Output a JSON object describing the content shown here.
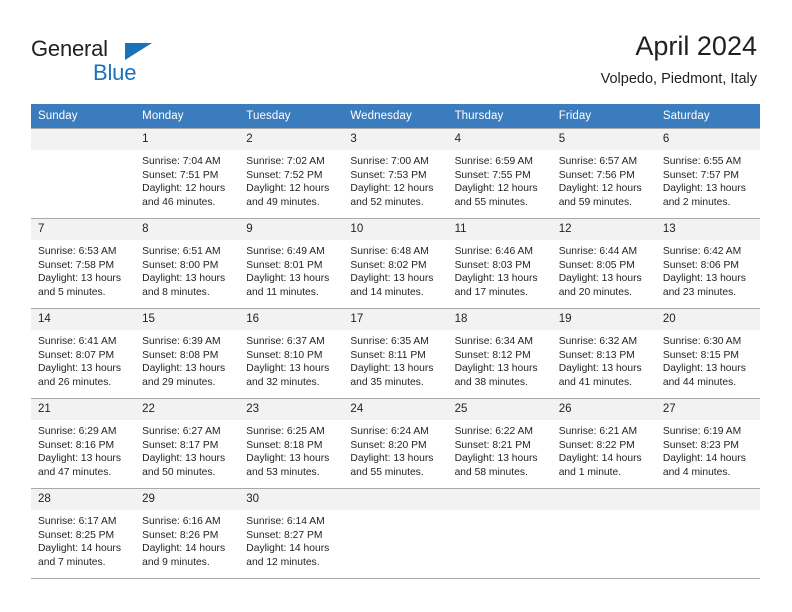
{
  "brand": {
    "name_part1": "General",
    "name_part2": "Blue",
    "accent_color": "#1b72b8"
  },
  "header": {
    "title": "April 2024",
    "subtitle": "Volpedo, Piedmont, Italy",
    "header_bg_color": "#3b7cbf",
    "daynum_bg_color": "#f2f2f2"
  },
  "weekday_headers": [
    "Sunday",
    "Monday",
    "Tuesday",
    "Wednesday",
    "Thursday",
    "Friday",
    "Saturday"
  ],
  "weeks": [
    [
      {
        "day": "",
        "blank": true,
        "l1": "",
        "l2": "",
        "l3": "",
        "l4": ""
      },
      {
        "day": "1",
        "l1": "Sunrise: 7:04 AM",
        "l2": "Sunset: 7:51 PM",
        "l3": "Daylight: 12 hours",
        "l4": "and 46 minutes."
      },
      {
        "day": "2",
        "l1": "Sunrise: 7:02 AM",
        "l2": "Sunset: 7:52 PM",
        "l3": "Daylight: 12 hours",
        "l4": "and 49 minutes."
      },
      {
        "day": "3",
        "l1": "Sunrise: 7:00 AM",
        "l2": "Sunset: 7:53 PM",
        "l3": "Daylight: 12 hours",
        "l4": "and 52 minutes."
      },
      {
        "day": "4",
        "l1": "Sunrise: 6:59 AM",
        "l2": "Sunset: 7:55 PM",
        "l3": "Daylight: 12 hours",
        "l4": "and 55 minutes."
      },
      {
        "day": "5",
        "l1": "Sunrise: 6:57 AM",
        "l2": "Sunset: 7:56 PM",
        "l3": "Daylight: 12 hours",
        "l4": "and 59 minutes."
      },
      {
        "day": "6",
        "l1": "Sunrise: 6:55 AM",
        "l2": "Sunset: 7:57 PM",
        "l3": "Daylight: 13 hours",
        "l4": "and 2 minutes."
      }
    ],
    [
      {
        "day": "7",
        "l1": "Sunrise: 6:53 AM",
        "l2": "Sunset: 7:58 PM",
        "l3": "Daylight: 13 hours",
        "l4": "and 5 minutes."
      },
      {
        "day": "8",
        "l1": "Sunrise: 6:51 AM",
        "l2": "Sunset: 8:00 PM",
        "l3": "Daylight: 13 hours",
        "l4": "and 8 minutes."
      },
      {
        "day": "9",
        "l1": "Sunrise: 6:49 AM",
        "l2": "Sunset: 8:01 PM",
        "l3": "Daylight: 13 hours",
        "l4": "and 11 minutes."
      },
      {
        "day": "10",
        "l1": "Sunrise: 6:48 AM",
        "l2": "Sunset: 8:02 PM",
        "l3": "Daylight: 13 hours",
        "l4": "and 14 minutes."
      },
      {
        "day": "11",
        "l1": "Sunrise: 6:46 AM",
        "l2": "Sunset: 8:03 PM",
        "l3": "Daylight: 13 hours",
        "l4": "and 17 minutes."
      },
      {
        "day": "12",
        "l1": "Sunrise: 6:44 AM",
        "l2": "Sunset: 8:05 PM",
        "l3": "Daylight: 13 hours",
        "l4": "and 20 minutes."
      },
      {
        "day": "13",
        "l1": "Sunrise: 6:42 AM",
        "l2": "Sunset: 8:06 PM",
        "l3": "Daylight: 13 hours",
        "l4": "and 23 minutes."
      }
    ],
    [
      {
        "day": "14",
        "l1": "Sunrise: 6:41 AM",
        "l2": "Sunset: 8:07 PM",
        "l3": "Daylight: 13 hours",
        "l4": "and 26 minutes."
      },
      {
        "day": "15",
        "l1": "Sunrise: 6:39 AM",
        "l2": "Sunset: 8:08 PM",
        "l3": "Daylight: 13 hours",
        "l4": "and 29 minutes."
      },
      {
        "day": "16",
        "l1": "Sunrise: 6:37 AM",
        "l2": "Sunset: 8:10 PM",
        "l3": "Daylight: 13 hours",
        "l4": "and 32 minutes."
      },
      {
        "day": "17",
        "l1": "Sunrise: 6:35 AM",
        "l2": "Sunset: 8:11 PM",
        "l3": "Daylight: 13 hours",
        "l4": "and 35 minutes."
      },
      {
        "day": "18",
        "l1": "Sunrise: 6:34 AM",
        "l2": "Sunset: 8:12 PM",
        "l3": "Daylight: 13 hours",
        "l4": "and 38 minutes."
      },
      {
        "day": "19",
        "l1": "Sunrise: 6:32 AM",
        "l2": "Sunset: 8:13 PM",
        "l3": "Daylight: 13 hours",
        "l4": "and 41 minutes."
      },
      {
        "day": "20",
        "l1": "Sunrise: 6:30 AM",
        "l2": "Sunset: 8:15 PM",
        "l3": "Daylight: 13 hours",
        "l4": "and 44 minutes."
      }
    ],
    [
      {
        "day": "21",
        "l1": "Sunrise: 6:29 AM",
        "l2": "Sunset: 8:16 PM",
        "l3": "Daylight: 13 hours",
        "l4": "and 47 minutes."
      },
      {
        "day": "22",
        "l1": "Sunrise: 6:27 AM",
        "l2": "Sunset: 8:17 PM",
        "l3": "Daylight: 13 hours",
        "l4": "and 50 minutes."
      },
      {
        "day": "23",
        "l1": "Sunrise: 6:25 AM",
        "l2": "Sunset: 8:18 PM",
        "l3": "Daylight: 13 hours",
        "l4": "and 53 minutes."
      },
      {
        "day": "24",
        "l1": "Sunrise: 6:24 AM",
        "l2": "Sunset: 8:20 PM",
        "l3": "Daylight: 13 hours",
        "l4": "and 55 minutes."
      },
      {
        "day": "25",
        "l1": "Sunrise: 6:22 AM",
        "l2": "Sunset: 8:21 PM",
        "l3": "Daylight: 13 hours",
        "l4": "and 58 minutes."
      },
      {
        "day": "26",
        "l1": "Sunrise: 6:21 AM",
        "l2": "Sunset: 8:22 PM",
        "l3": "Daylight: 14 hours",
        "l4": "and 1 minute."
      },
      {
        "day": "27",
        "l1": "Sunrise: 6:19 AM",
        "l2": "Sunset: 8:23 PM",
        "l3": "Daylight: 14 hours",
        "l4": "and 4 minutes."
      }
    ],
    [
      {
        "day": "28",
        "l1": "Sunrise: 6:17 AM",
        "l2": "Sunset: 8:25 PM",
        "l3": "Daylight: 14 hours",
        "l4": "and 7 minutes."
      },
      {
        "day": "29",
        "l1": "Sunrise: 6:16 AM",
        "l2": "Sunset: 8:26 PM",
        "l3": "Daylight: 14 hours",
        "l4": "and 9 minutes."
      },
      {
        "day": "30",
        "l1": "Sunrise: 6:14 AM",
        "l2": "Sunset: 8:27 PM",
        "l3": "Daylight: 14 hours",
        "l4": "and 12 minutes."
      },
      {
        "day": "",
        "blank": true,
        "l1": "",
        "l2": "",
        "l3": "",
        "l4": ""
      },
      {
        "day": "",
        "blank": true,
        "l1": "",
        "l2": "",
        "l3": "",
        "l4": ""
      },
      {
        "day": "",
        "blank": true,
        "l1": "",
        "l2": "",
        "l3": "",
        "l4": ""
      },
      {
        "day": "",
        "blank": true,
        "l1": "",
        "l2": "",
        "l3": "",
        "l4": ""
      }
    ]
  ]
}
